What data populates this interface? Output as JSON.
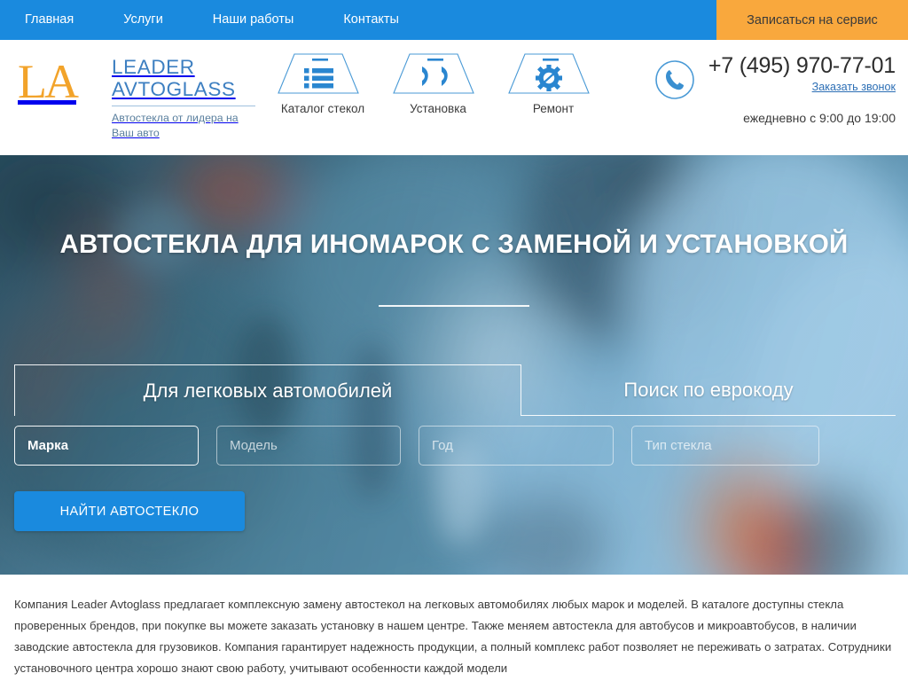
{
  "topbar": {
    "nav": [
      {
        "label": "Главная"
      },
      {
        "label": "Услуги"
      },
      {
        "label": "Наши работы"
      },
      {
        "label": "Контакты"
      }
    ],
    "cta_label": "Записаться на сервис",
    "bg_color": "#1a8ade",
    "cta_color": "#f9a83d"
  },
  "header": {
    "logo_mark": "LA",
    "logo_line1": "LEADER",
    "logo_line2": "AVTOGLASS",
    "logo_tagline": "Автостекла от лидера на Ваш авто",
    "logo_mark_color": "#f2a32a",
    "logo_text_color": "#3d7fc1",
    "icon_nav": [
      {
        "label": "Каталог стекол",
        "icon": "catalog-list-icon"
      },
      {
        "label": "Установка",
        "icon": "installation-hands-icon"
      },
      {
        "label": "Ремонт",
        "icon": "repair-gear-icon"
      }
    ],
    "phone": "+7 (495) 970-77-01",
    "callback_label": "Заказать звонок",
    "hours": "ежедневно с 9:00 до 19:00",
    "phone_icon": "phone-circle-icon"
  },
  "hero": {
    "title": "АВТОСТЕКЛА ДЛЯ ИНОМАРОК С ЗАМЕНОЙ И УСТАНОВКОЙ",
    "tabs": [
      {
        "label": "Для легковых автомобилей",
        "active": true
      },
      {
        "label": "Поиск по еврокоду",
        "active": false
      }
    ],
    "fields": [
      {
        "value": "Марка",
        "placeholder": "Марка",
        "filled": true
      },
      {
        "value": "",
        "placeholder": "Модель",
        "filled": false
      },
      {
        "value": "",
        "placeholder": "Год",
        "filled": false
      },
      {
        "value": "",
        "placeholder": "Тип стекла",
        "filled": false
      }
    ],
    "search_button": "НАЙТИ АВТОСТЕКЛО",
    "button_color": "#1a8ade"
  },
  "intro": {
    "text": "Компания Leader Avtoglass предлагает комплексную замену автостекол на легковых автомобилях любых марок и моделей. В каталоге доступны стекла проверенных брендов, при покупке вы можете заказать установку в нашем центре. Также меняем автостекла для автобусов и микроавтобусов, в наличии заводские автостекла для грузовиков. Компания гарантирует надежность продукции, а полный комплекс работ позволяет не переживать о затратах. Сотрудники установочного центра хорошо знают свою работу, учитывают особенности каждой модели"
  }
}
